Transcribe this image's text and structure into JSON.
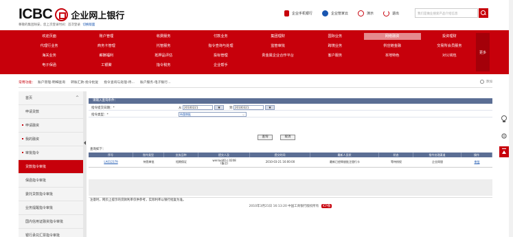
{
  "header": {
    "logo_text": "ICBC",
    "logo_cn": "企业网上银行",
    "welcome": "尊敬的集团除安，您上次登录时间：首次登录",
    "switch_label": "切换版面",
    "top_links": [
      {
        "label": "企业手机银行",
        "icon": "phone-icon",
        "color": "#c7000b"
      },
      {
        "label": "企业管家云",
        "icon": "cloud-icon",
        "color": "#1a56b0"
      },
      {
        "label": "演示",
        "icon": "demo-icon",
        "color": "#c7000b"
      },
      {
        "label": "退出",
        "icon": "power-icon",
        "color": "#c7000b"
      }
    ],
    "search_placeholder": "我们是做业搜索产品介绍信息"
  },
  "nav": {
    "rows": [
      [
        "欢迎页面",
        "账户管理",
        "收费服务",
        "付款业务",
        "集团理财",
        "国际业务",
        "网络融资",
        "投资理财"
      ],
      [
        "代理行业务",
        "商务卡管理",
        "托管服务",
        "指令查询与处理",
        "监管审批",
        "跨境业务",
        "供应链金融",
        "交易所会员服务"
      ],
      [
        "海关业务",
        "薪酬福利",
        "抵押品评估",
        "投标管理",
        "贵金属企业合作平台",
        "客户服务",
        "本地特色",
        "对公钱包"
      ],
      [
        "电子保函",
        "工银聚",
        "指令税务",
        "企业帮手",
        "",
        "",
        "",
        ""
      ]
    ],
    "active": "网络融资",
    "more_label": "更多"
  },
  "quick": {
    "label": "常用功能：",
    "items": [
      "账户管理-明细查询",
      "转账汇款-指令批复",
      "指令查询与处理-待...",
      "账户服务-电子银行..."
    ],
    "add_label": "添加"
  },
  "sidebar": {
    "items": [
      {
        "label": "首页",
        "type": "top"
      },
      {
        "label": "申请贷款",
        "type": "child"
      },
      {
        "label": "申请融资",
        "type": "parent"
      },
      {
        "label": "我的融资",
        "type": "parent"
      },
      {
        "label": "审批指令",
        "type": "parent"
      },
      {
        "label": "贷款指令审批",
        "type": "active"
      },
      {
        "label": "保函指令审批",
        "type": "child"
      },
      {
        "label": "委托贷款指令审批",
        "type": "child"
      },
      {
        "label": "业务提醒指令审批",
        "type": "child"
      },
      {
        "label": "国内信用证融资指令审批",
        "type": "child"
      },
      {
        "label": "银行承兑汇票指令审批",
        "type": "child"
      }
    ]
  },
  "form": {
    "title": "请输入查询条件：",
    "date_label": "指令提交日期：*",
    "from_label": "从",
    "from_date": "20100221",
    "to_label": "到",
    "to_date": "20100321",
    "cal_label": "▼",
    "type_label": "指令类型：*",
    "type_value": "待我审批",
    "query_btn": "查询",
    "reset_btn": "取消"
  },
  "results": {
    "label": "查询如下：",
    "columns": [
      "序号",
      "指令类型",
      "业务品种",
      "提交人及",
      "提交时间",
      "最新人员状",
      "状态",
      "指令处理渠道",
      "操作"
    ],
    "rows": [
      {
        "no": "LA012379",
        "type": "待我审批",
        "product": "短期保证",
        "submitter": "wenluo00.c.0208",
        "submitter_note": "(备注)",
        "time": "2010-03-21 16:00:00",
        "person_status": "最新已经释放批注银行卡",
        "status": "等待授权",
        "channel": "企业网银",
        "action": "审批"
      }
    ]
  },
  "tip": "注意时，网页上提示的贷款利率仅供参考，实际利率以银行批复为准。",
  "footer": {
    "text": "2010年3月21日 16:13:20  中国工商银行版权所有",
    "badge": "ICP备"
  }
}
